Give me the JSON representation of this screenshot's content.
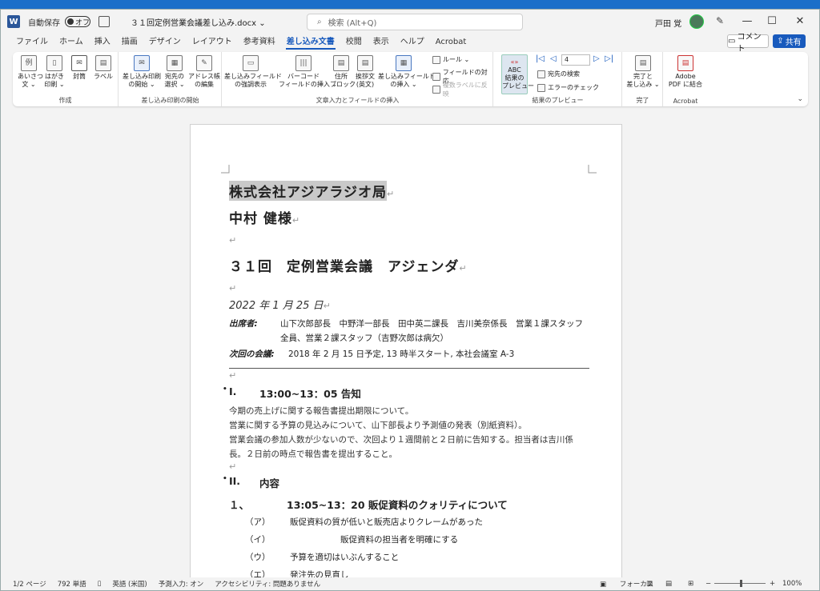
{
  "titlebar": {
    "autosave": "自動保存",
    "toggle": "オフ",
    "doc_title": "３１回定例営業会議差し込み.docx",
    "doc_title_caret": "⌄",
    "search_placeholder": "検索 (Alt+Q)",
    "user": "戸田 覚"
  },
  "menu": [
    "ファイル",
    "ホーム",
    "挿入",
    "描画",
    "デザイン",
    "レイアウト",
    "参考資料",
    "差し込み文書",
    "校閲",
    "表示",
    "ヘルプ",
    "Acrobat"
  ],
  "menu_active_index": 7,
  "comment_btn": "コメント",
  "share_btn": "共有",
  "ribbon": {
    "create": {
      "label": "作成",
      "btns": [
        "あいさつ\n文 ⌄",
        "はがき\n印刷 ⌄",
        "封筒",
        "ラベル"
      ]
    },
    "start": {
      "label": "差し込み印刷の開始",
      "btns": [
        "差し込み印刷\nの開始 ⌄",
        "宛先の\n選択 ⌄",
        "アドレス帳\nの編集"
      ]
    },
    "fields": {
      "label": "文章入力とフィールドの挿入",
      "btns": [
        "差し込みフィールド\nの強調表示",
        "バーコード\nフィールドの挿入 ⌄",
        "住所\nブロック",
        "挨拶文\n(英文)",
        "差し込みフィールド\nの挿入 ⌄"
      ],
      "small": [
        "ルール ⌄",
        "フィールドの対応",
        "複数ラベルに反映"
      ]
    },
    "preview": {
      "label": "結果のプレビュー",
      "btn": "結果の\nプレビュー",
      "abc": "ABC",
      "record": "4",
      "small": [
        "宛先の検索",
        "エラーのチェック"
      ]
    },
    "finish": {
      "label": "完了",
      "btn": "完了と\n差し込み ⌄"
    },
    "acrobat": {
      "label": "Acrobat",
      "btn": "Adobe\nPDF に結合"
    }
  },
  "doc": {
    "company": "株式会社アジアラジオ局",
    "name": "中村 健様",
    "meeting": "３１回　定例営業会議　アジェンダ",
    "date": "2022 年 1 月 25 日",
    "attendees_label": "出席者:",
    "attendees": "山下次郎部長　中野洋一部長　田中英二課長　吉川美奈係長　営業１課スタッフ全員、営業２課スタッフ（吉野次郎は病欠）",
    "next_label": "次回の会議:",
    "next": "2018 年 2 月 15 日予定, 13 時半スタート, 本社会議室 A-3",
    "sec1_num": "I.",
    "sec1_title": "13:00~13：05 告知",
    "sec1_paras": [
      "今期の売上げに関する報告書提出期限について。",
      "営業に関する予算の見込みについて、山下部長より予測値の発表（別紙資料）。",
      "営業会議の参加人数が少ないので、次回より１週間前と２日前に告知する。担当者は吉川係長。２日前の時点で報告書を提出すること。"
    ],
    "sec2_num": "II.",
    "sec2_title": "内容",
    "sub1_num": "１、",
    "sub1_title": "13:05~13：20 販促資料のクォリティについて",
    "items": [
      {
        "k": "（ア）",
        "v": "販促資料の質が低いと販売店よりクレームがあった"
      },
      {
        "k": "（イ）",
        "v": "　　　　　　販促資料の担当者を明確にする"
      },
      {
        "k": "（ウ）",
        "v": "予算を適切はいぶんすること"
      },
      {
        "k": "（エ）",
        "v": "発注先の見直し"
      }
    ]
  },
  "status": {
    "page": "1/2 ページ",
    "words": "792 単語",
    "lang": "英語 (米国)",
    "predict": "予測入力: オン",
    "access": "アクセシビリティ: 問題ありません",
    "focus": "フォーカス",
    "zoom": "100%"
  }
}
